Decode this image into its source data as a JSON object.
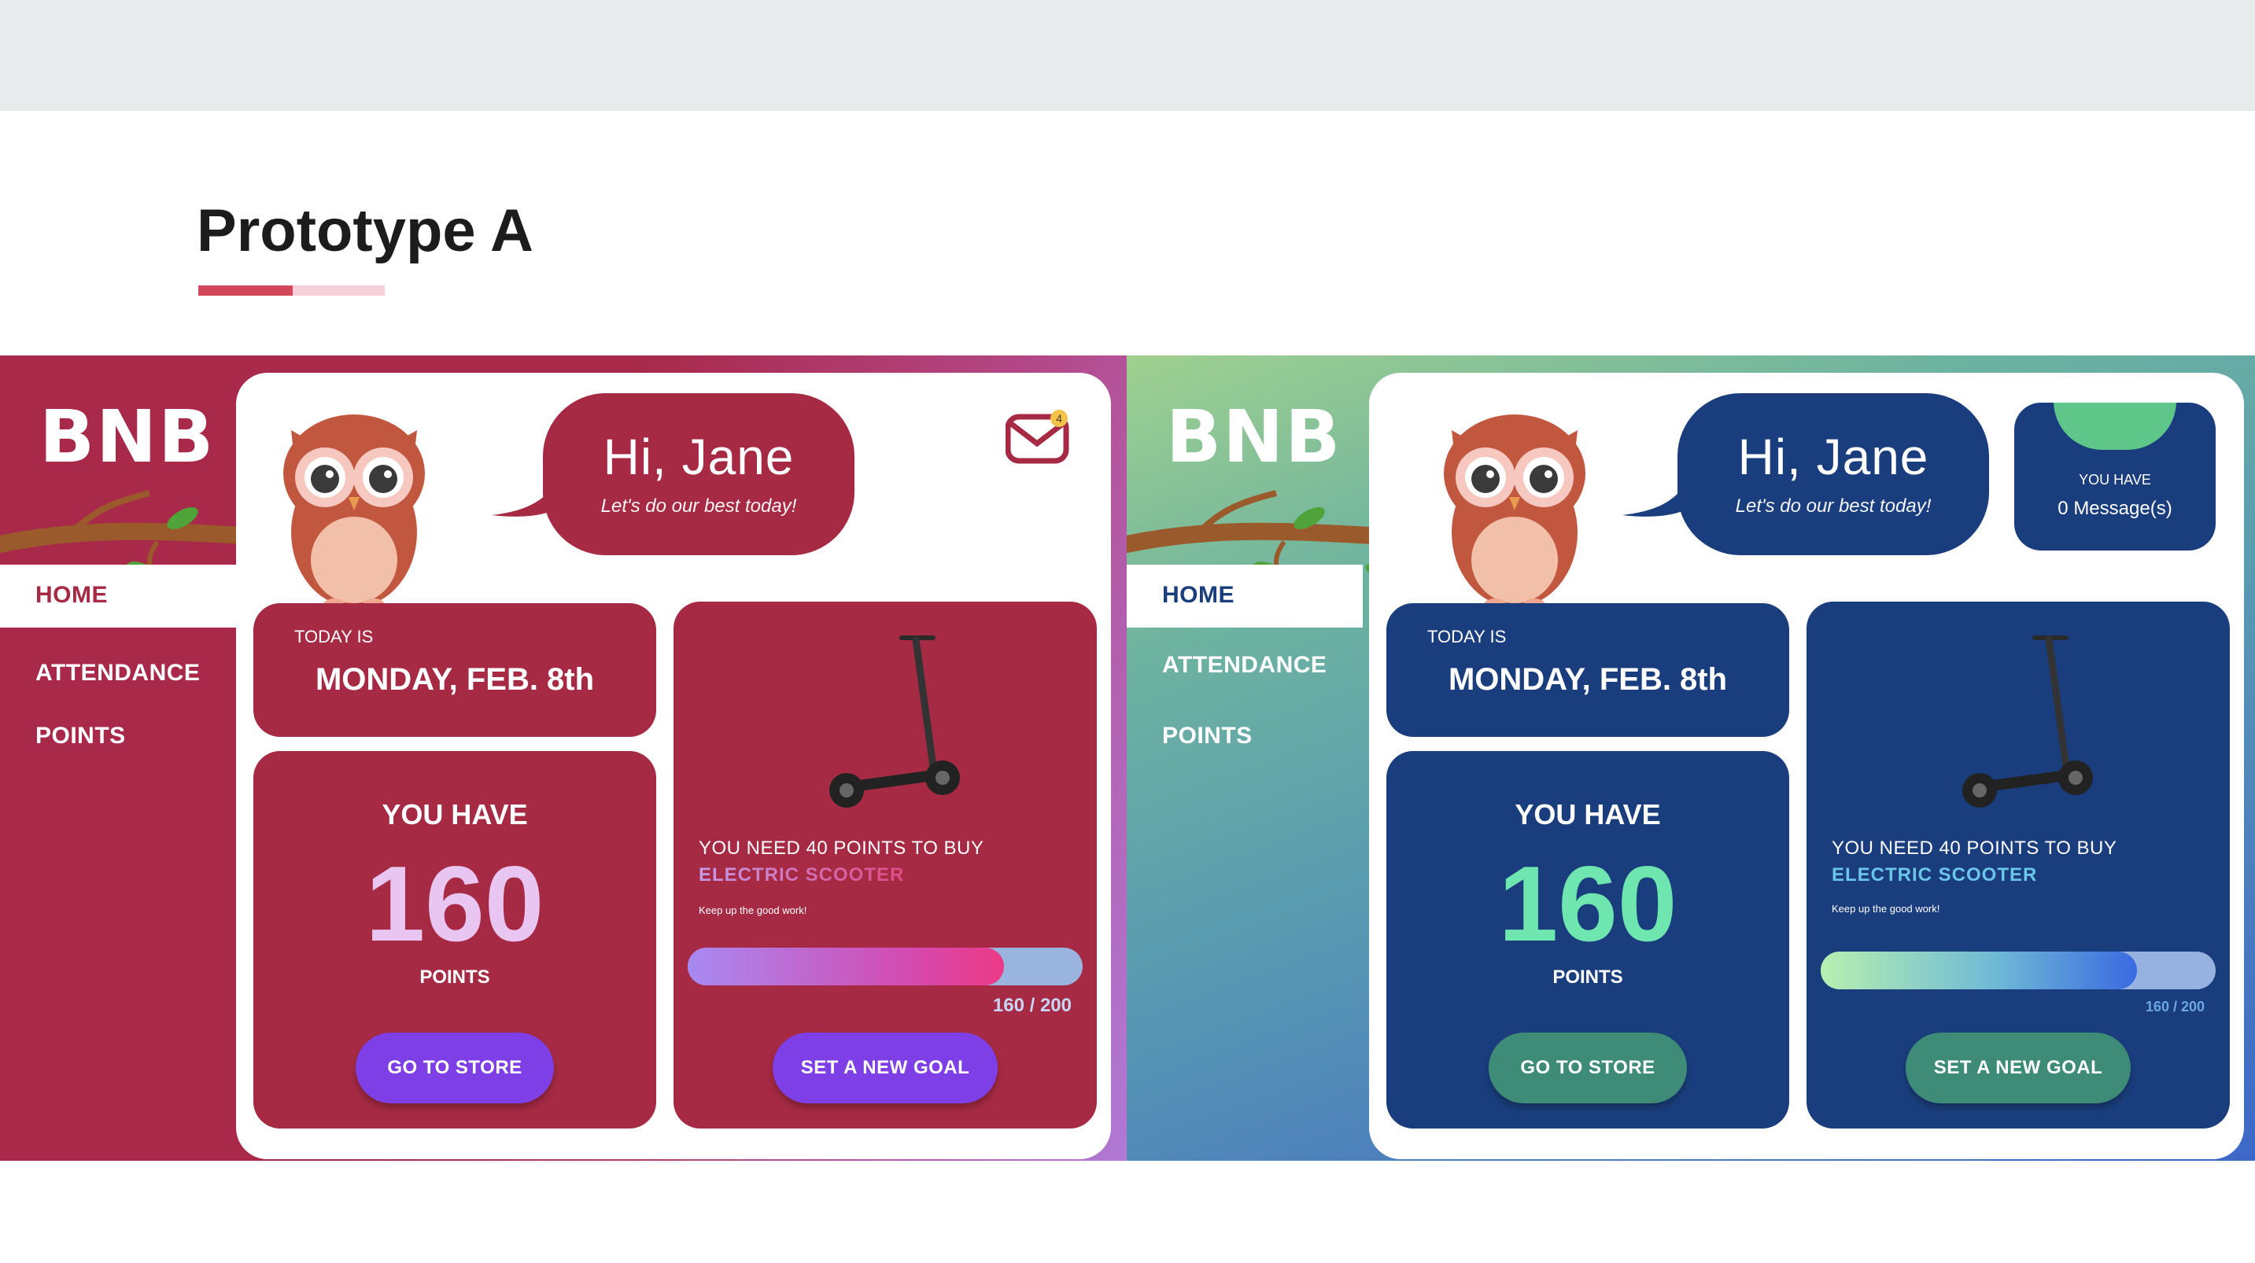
{
  "page": {
    "title": "Prototype A",
    "underline_colors": [
      "#d2475a",
      "#f7cfd6"
    ]
  },
  "prototypes": [
    {
      "id": "A",
      "logo": "BNB",
      "nav": {
        "home": "HOME",
        "attendance": "ATTENDANCE",
        "points": "POINTS"
      },
      "greeting": {
        "title": "Hi, Jane",
        "subtitle": "Let's do our best today!"
      },
      "mail": {
        "badge": "4",
        "icon": "mail-icon"
      },
      "date": {
        "label": "TODAY IS",
        "value": "MONDAY, FEB. 8th"
      },
      "points": {
        "label": "YOU HAVE",
        "value": "160",
        "unit": "POINTS",
        "button": "GO TO STORE"
      },
      "goal": {
        "need": "YOU NEED 40 POINTS TO BUY",
        "item": "ELECTRIC SCOOTER",
        "note": "Keep up the good work!",
        "progress_text": "160 / 200",
        "progress_fraction": 0.8,
        "button": "SET A NEW GOAL"
      },
      "colors": {
        "primary": "#a62a44",
        "accent_button": "#7f3fe6",
        "points_number": "#e9c6f2"
      }
    },
    {
      "id": "B",
      "logo": "BNB",
      "nav": {
        "home": "HOME",
        "attendance": "ATTENDANCE",
        "points": "POINTS"
      },
      "greeting": {
        "title": "Hi, Jane",
        "subtitle": "Let's do our best today!"
      },
      "messages": {
        "label": "YOU HAVE",
        "value": "0 Message(s)"
      },
      "date": {
        "label": "TODAY IS",
        "value": "MONDAY, FEB. 8th"
      },
      "points": {
        "label": "YOU HAVE",
        "value": "160",
        "unit": "POINTS",
        "button": "GO TO STORE"
      },
      "goal": {
        "need": "YOU NEED 40 POINTS TO BUY",
        "item": "ELECTRIC SCOOTER",
        "note": "Keep up the good work!",
        "progress_text": "160 / 200",
        "progress_fraction": 0.8,
        "button": "SET A NEW GOAL"
      },
      "colors": {
        "primary": "#1a3e7d",
        "accent_button": "#3e8c77",
        "points_number": "#6fe5b0"
      }
    }
  ]
}
